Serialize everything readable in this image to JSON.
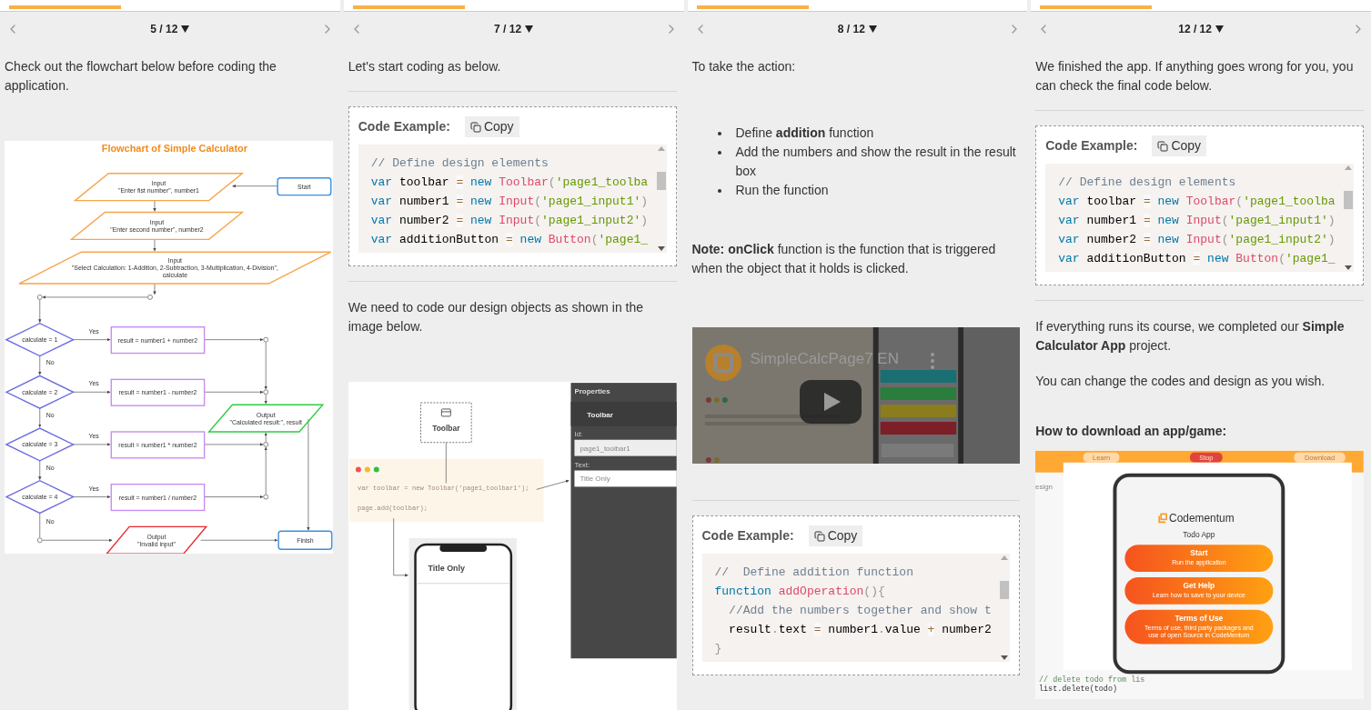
{
  "panels": [
    {
      "page": "5 / 12",
      "blocks": [
        {
          "kind": "text",
          "text": "Check out the flowchart below before coding the application."
        },
        {
          "kind": "flowchart",
          "title": "Flowchart of Simple Calculator",
          "nodes": [
            {
              "kind": "io",
              "color": "#f5a54a",
              "lines": [
                "Input",
                "\"Enter fist number\", number1"
              ]
            },
            {
              "kind": "terminal",
              "color": "#3b8de0",
              "lines": [
                "Start"
              ]
            },
            {
              "kind": "io",
              "color": "#f5a54a",
              "lines": [
                "Input",
                "\"Enter second number\", number2"
              ]
            },
            {
              "kind": "io",
              "color": "#f5a54a",
              "lines": [
                "Input",
                "\"Select Calculation: 1-Addition, 2-Subtraction, 3-Multiplication, 4-Division\",",
                "calculate"
              ]
            },
            {
              "kind": "decision",
              "color": "#6b6be0",
              "lines": [
                "calculate = 1"
              ]
            },
            {
              "kind": "process",
              "color": "#c88df2",
              "lines": [
                "result = number1 + number2"
              ]
            },
            {
              "kind": "decision",
              "color": "#6b6be0",
              "lines": [
                "calculate = 2"
              ]
            },
            {
              "kind": "process",
              "color": "#c88df2",
              "lines": [
                "result = number1 - number2"
              ]
            },
            {
              "kind": "decision",
              "color": "#6b6be0",
              "lines": [
                "calculate = 3"
              ]
            },
            {
              "kind": "process",
              "color": "#c88df2",
              "lines": [
                "result = number1 * number2"
              ]
            },
            {
              "kind": "decision",
              "color": "#6b6be0",
              "lines": [
                "calculate = 4"
              ]
            },
            {
              "kind": "process",
              "color": "#c88df2",
              "lines": [
                "result = number1 / number2"
              ]
            },
            {
              "kind": "io",
              "color": "#2ecc40",
              "lines": [
                "Output",
                "\"Calculated result:\", result"
              ]
            },
            {
              "kind": "io",
              "color": "#e8282d",
              "lines": [
                "Output",
                "\"Invalid input\""
              ]
            },
            {
              "kind": "terminal",
              "color": "#3b8de0",
              "lines": [
                "Finish"
              ]
            }
          ],
          "branch_labels": [
            "Yes",
            "No",
            "Yes",
            "No",
            "Yes",
            "No",
            "Yes",
            "No"
          ]
        }
      ]
    },
    {
      "page": "7 / 12",
      "blocks": [
        {
          "kind": "text",
          "text": "Let's start coding as below."
        },
        {
          "kind": "divider"
        },
        {
          "kind": "code",
          "heading": "Code Example:",
          "copy": "Copy",
          "lines": [
            {
              "tokens": [
                {
                  "kind": "comment",
                  "text": "// Define design elements"
                }
              ]
            },
            {
              "tokens": [
                {
                  "kind": "keyword",
                  "text": "var"
                },
                {
                  "kind": "plain",
                  "text": " toolbar "
                },
                {
                  "kind": "operator",
                  "text": "="
                },
                {
                  "kind": "keyword",
                  "text": " new "
                },
                {
                  "kind": "function",
                  "text": "Toolbar"
                },
                {
                  "kind": "punct",
                  "text": "("
                },
                {
                  "kind": "string",
                  "text": "'page1_toolba"
                }
              ]
            },
            {
              "tokens": [
                {
                  "kind": "keyword",
                  "text": "var"
                },
                {
                  "kind": "plain",
                  "text": " number1 "
                },
                {
                  "kind": "operator",
                  "text": "="
                },
                {
                  "kind": "keyword",
                  "text": " new "
                },
                {
                  "kind": "function",
                  "text": "Input"
                },
                {
                  "kind": "punct",
                  "text": "("
                },
                {
                  "kind": "string",
                  "text": "'page1_input1'"
                },
                {
                  "kind": "punct",
                  "text": ")"
                }
              ]
            },
            {
              "tokens": [
                {
                  "kind": "keyword",
                  "text": "var"
                },
                {
                  "kind": "plain",
                  "text": " number2 "
                },
                {
                  "kind": "operator",
                  "text": "="
                },
                {
                  "kind": "keyword",
                  "text": " new "
                },
                {
                  "kind": "function",
                  "text": "Input"
                },
                {
                  "kind": "punct",
                  "text": "("
                },
                {
                  "kind": "string",
                  "text": "'page1_input2'"
                },
                {
                  "kind": "punct",
                  "text": ")"
                }
              ]
            },
            {
              "tokens": [
                {
                  "kind": "keyword",
                  "text": "var"
                },
                {
                  "kind": "plain",
                  "text": " additionButton "
                },
                {
                  "kind": "operator",
                  "text": "="
                },
                {
                  "kind": "keyword",
                  "text": " new "
                },
                {
                  "kind": "function",
                  "text": "Button"
                },
                {
                  "kind": "punct",
                  "text": "("
                },
                {
                  "kind": "string",
                  "text": "'page1_"
                }
              ]
            }
          ]
        },
        {
          "kind": "divider"
        },
        {
          "kind": "text",
          "text": "We need to code our design objects as shown in the image below."
        },
        {
          "kind": "design_image",
          "toolbar_label": "Toolbar",
          "code_lines": [
            "var toolbar = new Toolbar('page1_toolbar1');",
            "page.add(toolbar);"
          ],
          "phone_title": "Title Only",
          "properties_title": "Properties",
          "component": "Toolbar",
          "id_label": "Id:",
          "id_value": "page1_toolbar1",
          "text_label": "Text:",
          "text_value": "Title Only"
        }
      ]
    },
    {
      "page": "8 / 12",
      "blocks": [
        {
          "kind": "text",
          "text": "To take the action:"
        },
        {
          "kind": "bullets",
          "items": [
            "Define **addition** function",
            "Add the numbers and show the result in the result box",
            "Run the function"
          ]
        },
        {
          "kind": "text",
          "text": "**Note:** **onClick** function is the function that is triggered when the object that it holds is clicked."
        },
        {
          "kind": "video",
          "title": "SimpleCalcPage7 EN"
        },
        {
          "kind": "divider"
        },
        {
          "kind": "code",
          "heading": "Code Example:",
          "copy": "Copy",
          "lines": [
            {
              "tokens": [
                {
                  "kind": "comment",
                  "text": "//  Define addition function"
                }
              ]
            },
            {
              "tokens": [
                {
                  "kind": "keyword",
                  "text": "function "
                },
                {
                  "kind": "function",
                  "text": "addOperation"
                },
                {
                  "kind": "punct",
                  "text": "(){"
                }
              ]
            },
            {
              "tokens": [
                {
                  "kind": "comment",
                  "text": "  //Add the numbers together and show t"
                }
              ]
            },
            {
              "tokens": [
                {
                  "kind": "plain",
                  "text": "  result"
                },
                {
                  "kind": "punct",
                  "text": "."
                },
                {
                  "kind": "plain",
                  "text": "text "
                },
                {
                  "kind": "operator",
                  "text": "="
                },
                {
                  "kind": "plain",
                  "text": " number1"
                },
                {
                  "kind": "punct",
                  "text": "."
                },
                {
                  "kind": "plain",
                  "text": "value "
                },
                {
                  "kind": "operator",
                  "text": "+"
                },
                {
                  "kind": "plain",
                  "text": " number2"
                }
              ]
            },
            {
              "tokens": [
                {
                  "kind": "punct",
                  "text": "}"
                }
              ]
            }
          ]
        }
      ]
    },
    {
      "page": "12 / 12",
      "blocks": [
        {
          "kind": "text",
          "text": "We finished the app. If anything goes wrong for you, you can check the final code below."
        },
        {
          "kind": "divider"
        },
        {
          "kind": "code",
          "heading": "Code Example:",
          "copy": "Copy",
          "lines": [
            {
              "tokens": [
                {
                  "kind": "comment",
                  "text": "// Define design elements"
                }
              ]
            },
            {
              "tokens": [
                {
                  "kind": "keyword",
                  "text": "var"
                },
                {
                  "kind": "plain",
                  "text": " toolbar "
                },
                {
                  "kind": "operator",
                  "text": "="
                },
                {
                  "kind": "keyword",
                  "text": " new "
                },
                {
                  "kind": "function",
                  "text": "Toolbar"
                },
                {
                  "kind": "punct",
                  "text": "("
                },
                {
                  "kind": "string",
                  "text": "'page1_toolba"
                }
              ]
            },
            {
              "tokens": [
                {
                  "kind": "keyword",
                  "text": "var"
                },
                {
                  "kind": "plain",
                  "text": " number1 "
                },
                {
                  "kind": "operator",
                  "text": "="
                },
                {
                  "kind": "keyword",
                  "text": " new "
                },
                {
                  "kind": "function",
                  "text": "Input"
                },
                {
                  "kind": "punct",
                  "text": "("
                },
                {
                  "kind": "string",
                  "text": "'page1_input1'"
                },
                {
                  "kind": "punct",
                  "text": ")"
                }
              ]
            },
            {
              "tokens": [
                {
                  "kind": "keyword",
                  "text": "var"
                },
                {
                  "kind": "plain",
                  "text": " number2 "
                },
                {
                  "kind": "operator",
                  "text": "="
                },
                {
                  "kind": "keyword",
                  "text": " new "
                },
                {
                  "kind": "function",
                  "text": "Input"
                },
                {
                  "kind": "punct",
                  "text": "("
                },
                {
                  "kind": "string",
                  "text": "'page1_input2'"
                },
                {
                  "kind": "punct",
                  "text": ")"
                }
              ]
            },
            {
              "tokens": [
                {
                  "kind": "keyword",
                  "text": "var"
                },
                {
                  "kind": "plain",
                  "text": " additionButton "
                },
                {
                  "kind": "operator",
                  "text": "="
                },
                {
                  "kind": "keyword",
                  "text": " new "
                },
                {
                  "kind": "function",
                  "text": "Button"
                },
                {
                  "kind": "punct",
                  "text": "("
                },
                {
                  "kind": "string",
                  "text": "'page1_"
                }
              ]
            }
          ]
        },
        {
          "kind": "divider"
        },
        {
          "kind": "text",
          "text": "If everything runs its course, we completed our **Simple Calculator App** project."
        },
        {
          "kind": "text",
          "text": "You can change the codes and design as you wish."
        },
        {
          "kind": "heading",
          "text": "How to download an app/game:"
        },
        {
          "kind": "app_image",
          "top_buttons": [
            "Learn",
            "Stop",
            "Download"
          ],
          "editor_tab": "esign",
          "editor_lines": [
            "// delete todo from lis",
            "list.delete(todo)"
          ],
          "brand": "Codementum",
          "app_title": "Todo App",
          "menu": [
            {
              "title": "Start",
              "lines": [
                "Run the application"
              ]
            },
            {
              "title": "Get Help",
              "lines": [
                "Learn how to save to your device"
              ]
            },
            {
              "title": "Terms of Use",
              "lines": [
                "Terms of use, third party packages and",
                "use of open Source in CodeMentum"
              ]
            }
          ]
        }
      ]
    }
  ]
}
